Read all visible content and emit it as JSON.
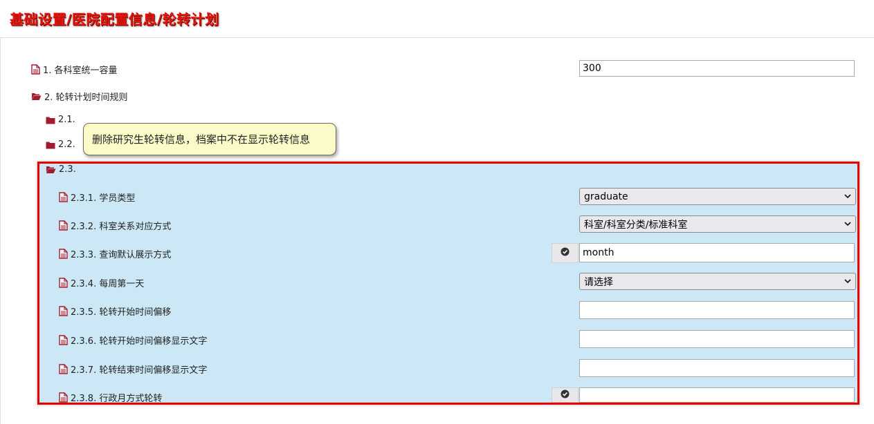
{
  "breadcrumb_title": "基础设置/医院配置信息/轮转计划",
  "tooltip": "删除研究生轮转信息，档案中不在显示轮转信息",
  "items": {
    "item1": {
      "label": "1. 各科室统一容量",
      "value": "300"
    },
    "item2": {
      "label": "2. 轮转计划时间规则"
    },
    "item21": {
      "label": "2.1."
    },
    "item22": {
      "label": "2.2."
    },
    "item23": {
      "label": "2.3."
    },
    "item231": {
      "label": "2.3.1. 学员类型",
      "selected": "graduate"
    },
    "item232": {
      "label": "2.3.2. 科室关系对应方式",
      "selected": "科室/科室分类/标准科室"
    },
    "item233": {
      "label": "2.3.3. 查询默认展示方式",
      "value": "month"
    },
    "item234": {
      "label": "2.3.4. 每周第一天",
      "selected": "请选择"
    },
    "item235": {
      "label": "2.3.5. 轮转开始时间偏移",
      "value": ""
    },
    "item236": {
      "label": "2.3.6. 轮转开始时间偏移显示文字",
      "value": ""
    },
    "item237": {
      "label": "2.3.7. 轮转结束时间偏移显示文字",
      "value": ""
    },
    "item238": {
      "label": "2.3.8. 行政月方式轮转",
      "value": ""
    }
  },
  "icons": {
    "document": "file-text-icon",
    "folder_open": "folder-open-icon",
    "folder_closed": "folder-icon",
    "check": "check-circle-icon"
  },
  "colors": {
    "title": "#e8180c",
    "icon": "#a31b2c",
    "highlight_bg": "#cce8f6",
    "highlight_border": "#e00000",
    "tooltip_bg": "#fbfbc9"
  }
}
